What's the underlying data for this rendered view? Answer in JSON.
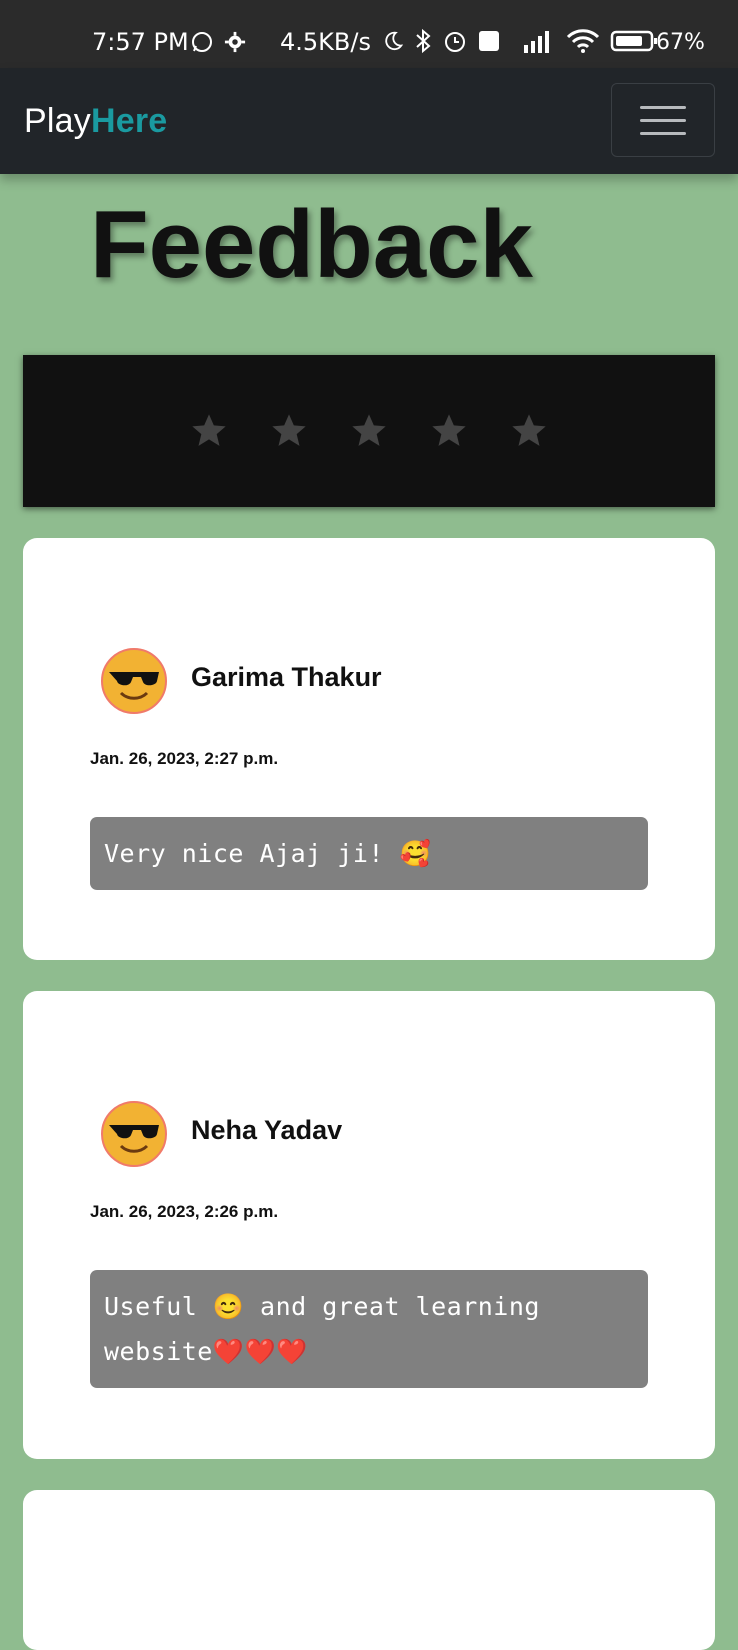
{
  "status_bar": {
    "time": "7:57 PM",
    "speed": "4.5KB/s",
    "battery": "67%"
  },
  "navbar": {
    "brand_play": "Play",
    "brand_here": "Here"
  },
  "page": {
    "title": "Feedback"
  },
  "rating": {
    "stars": 5,
    "star_color": "#444444"
  },
  "feedbacks": [
    {
      "name": "Garima Thakur",
      "date": "Jan. 26, 2023, 2:27 p.m.",
      "comment": "Very nice Ajaj ji! 🥰",
      "avatar": "sunglasses-emoji"
    },
    {
      "name": "Neha Yadav",
      "date": "Jan. 26, 2023, 2:26 p.m.",
      "comment": "Useful 😊 and great learning website❤️❤️❤️",
      "avatar": "sunglasses-emoji"
    }
  ],
  "colors": {
    "background": "#8fbc8f",
    "navbar": "#212529",
    "brand_accent": "#1a9aa0",
    "comment_bg": "#808080"
  }
}
